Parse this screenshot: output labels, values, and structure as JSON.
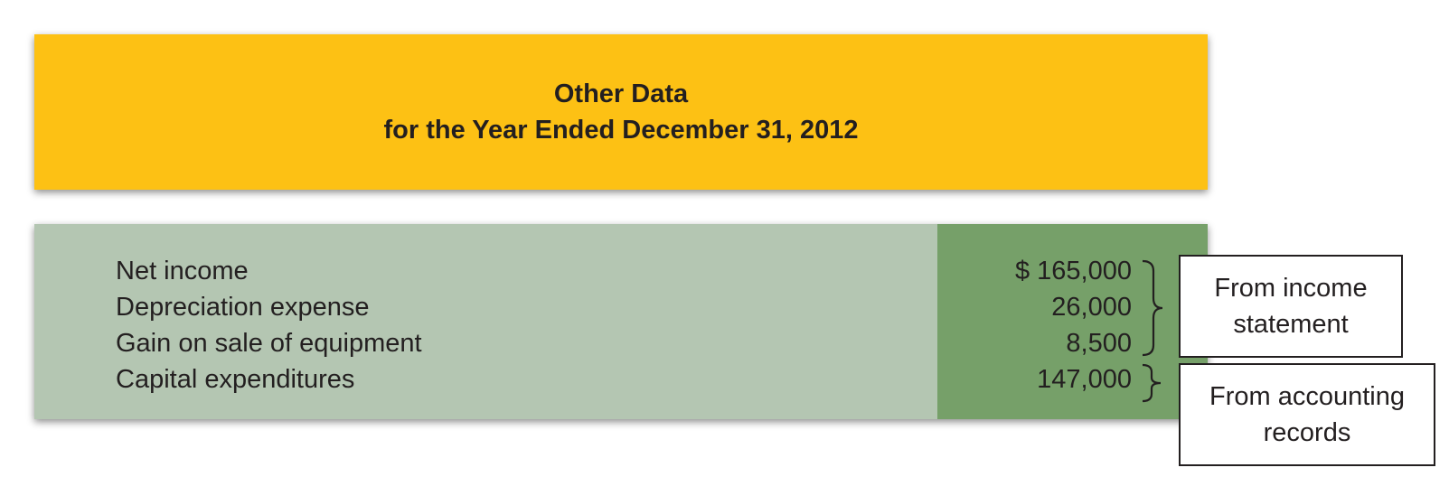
{
  "header": {
    "title_line1": "Other Data",
    "title_line2": "for the Year Ended December 31, 2012",
    "background_color": "#FDC114"
  },
  "table": {
    "label_background_color": "#B4C6B2",
    "amount_background_color": "#76A069",
    "rows": [
      {
        "label": "Net income",
        "amount": "$ 165,000"
      },
      {
        "label": "Depreciation expense",
        "amount": "26,000"
      },
      {
        "label": "Gain on sale of equipment",
        "amount": "8,500"
      },
      {
        "label": "Capital expenditures",
        "amount": "147,000"
      }
    ]
  },
  "callouts": {
    "income_statement": {
      "line1": "From income",
      "line2": "statement"
    },
    "accounting_records": {
      "line1": "From accounting",
      "line2": "records"
    }
  }
}
